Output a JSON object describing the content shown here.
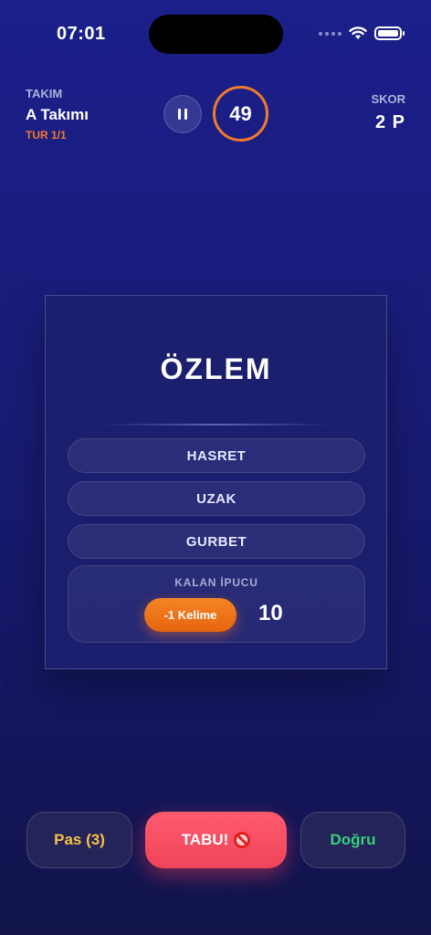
{
  "status_bar": {
    "time": "07:01",
    "icons": [
      "signal-dots-icon",
      "wifi-icon",
      "battery-icon"
    ]
  },
  "header": {
    "team_label": "TAKIM",
    "team_name": "A Takımı",
    "round": "TUR 1/1",
    "timer": "49",
    "score_label": "SKOR",
    "score_value": "2 P",
    "pause_icon": "pause-icon"
  },
  "card": {
    "word": "ÖZLEM",
    "taboo_words": [
      "HASRET",
      "UZAK",
      "GURBET"
    ],
    "hint_label": "KALAN İPUCU",
    "hint_button": "-1 Kelime",
    "hint_count": "10"
  },
  "actions": {
    "pass": "Pas (3)",
    "taboo": "TABU!",
    "taboo_icon": "no-entry-icon",
    "correct": "Doğru"
  },
  "colors": {
    "accent_orange": "#f07a2a",
    "taboo_red": "#f04459",
    "correct_green": "#35d07a",
    "pass_yellow": "#f5c445",
    "background": "#1a1c7a"
  }
}
